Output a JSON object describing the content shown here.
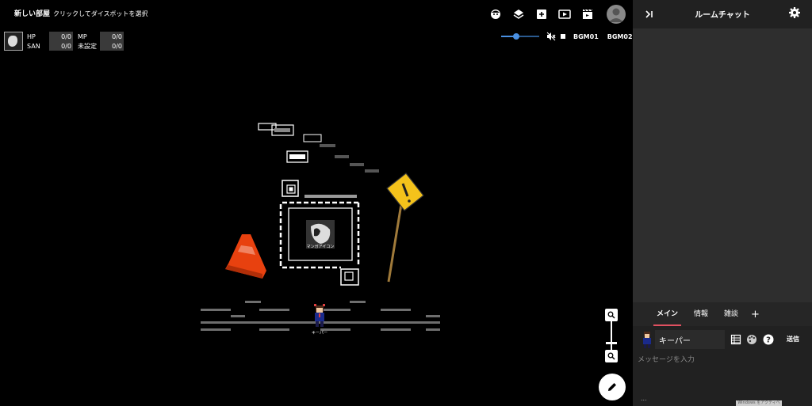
{
  "room": {
    "title": "新しい部屋",
    "hint": "クリックしてダイスボットを選択"
  },
  "status": {
    "rows": [
      {
        "a_label": "HP",
        "a_value": "0/0",
        "b_label": "MP",
        "b_value": "0/0"
      },
      {
        "a_label": "SAN",
        "a_value": "0/0",
        "b_label": "未設定",
        "b_value": "0/0"
      }
    ]
  },
  "toolbar": {
    "icons": [
      "character-icon",
      "layers-icon",
      "add-box-icon",
      "play-video-icon",
      "clapperboard-icon",
      "user-account-icon"
    ]
  },
  "audio": {
    "volume_level": 0.4,
    "bgm1": "BGM01",
    "bgm2": "BGM02"
  },
  "scene": {
    "stamp_label": "マンガアイコン",
    "token_label": "キーパー",
    "cone_color": "#e8410f",
    "sign_color": "#f4c21b"
  },
  "chat": {
    "title": "ルームチャット",
    "tabs": [
      {
        "label": "メイン",
        "active": true
      },
      {
        "label": "情報",
        "active": false
      },
      {
        "label": "雑談",
        "active": false
      }
    ],
    "add_tab": "+",
    "character_name": "キーパー",
    "send_label": "送信",
    "message_placeholder": "メッセージを入力",
    "footer": "...",
    "watermark": "Windows をアクティベート"
  },
  "colors": {
    "accent_tab": "#e05060",
    "slider": "#4a90e2",
    "panel_bg": "#2b2b2b"
  }
}
